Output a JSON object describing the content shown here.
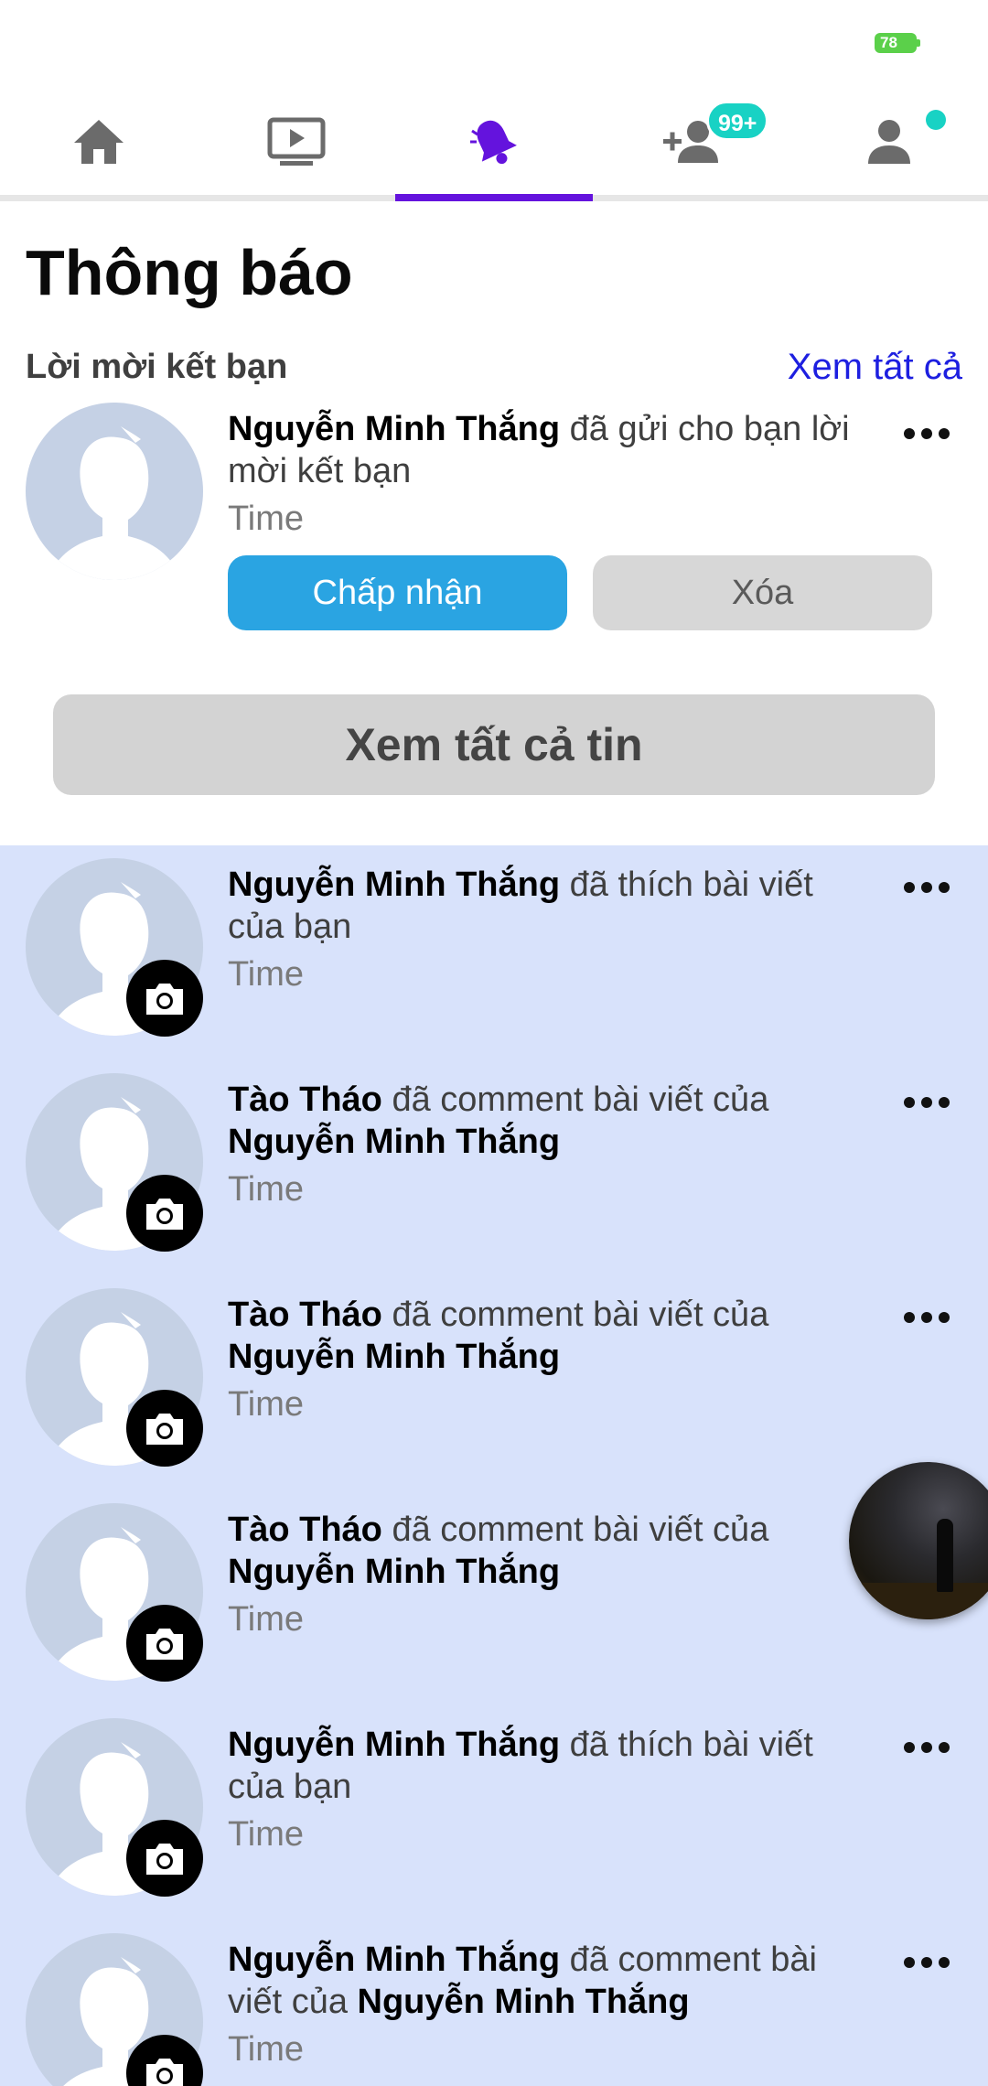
{
  "status_bar": {
    "battery_level": "78"
  },
  "tabs": [
    {
      "name": "home",
      "icon": "home-icon",
      "active": false
    },
    {
      "name": "video",
      "icon": "video-icon",
      "active": false
    },
    {
      "name": "notifications",
      "icon": "bell-icon",
      "active": true
    },
    {
      "name": "friends",
      "icon": "add-friend-icon",
      "active": false,
      "badge": "99+"
    },
    {
      "name": "profile",
      "icon": "profile-icon",
      "active": false,
      "dot": true
    }
  ],
  "colors": {
    "accent": "#6413dd",
    "badge": "#18d2c4",
    "accept": "#2aa4e2",
    "list_bg": "#d8e2fb",
    "link": "#1d1fe0"
  },
  "header": {
    "title": "Thông báo",
    "section_label": "Lời mời kết bạn",
    "see_all": "Xem tất cả"
  },
  "friend_request": {
    "name": "Nguyễn Minh Thắng",
    "text": " đã gửi cho bạn lời mời kết bạn",
    "time": "Time",
    "accept_label": "Chấp nhận",
    "delete_label": "Xóa"
  },
  "see_all_news_label": "Xem tất cả tin",
  "notifications": [
    {
      "actor": "Nguyễn Minh Thắng",
      "text": " đã thích bài viết của bạn",
      "target": "",
      "time": "Time"
    },
    {
      "actor": "Tào Tháo",
      "text": " đã comment bài viết của ",
      "target": "Nguyễn Minh Thắng",
      "time": "Time"
    },
    {
      "actor": "Tào Tháo",
      "text": " đã comment bài viết của ",
      "target": "Nguyễn Minh Thắng",
      "time": "Time"
    },
    {
      "actor": "Tào Tháo",
      "text": " đã comment bài viết của ",
      "target": "Nguyễn Minh Thắng",
      "time": "Time"
    },
    {
      "actor": "Nguyễn Minh Thắng",
      "text": " đã thích bài viết của bạn",
      "target": "",
      "time": "Time"
    },
    {
      "actor": "Nguyễn Minh Thắng",
      "text": " đã comment bài viết của ",
      "target": "Nguyễn Minh Thắng",
      "time": "Time"
    }
  ]
}
